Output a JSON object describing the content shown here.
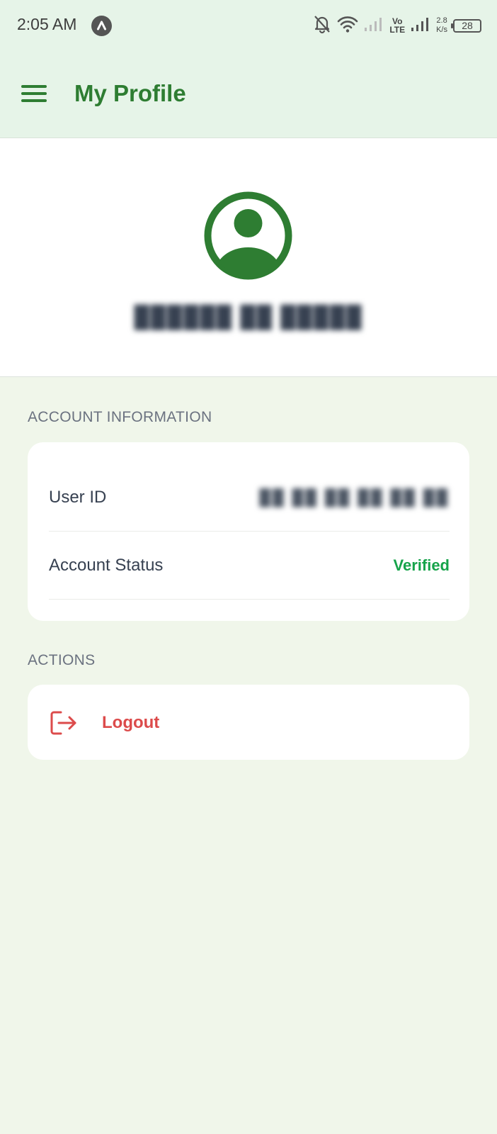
{
  "status_bar": {
    "time": "2:05 AM",
    "app_icon": "a-icon",
    "volte_top": "Vo",
    "volte_bottom": "LTE",
    "net_speed_value": "2.8",
    "net_speed_unit": "K/s",
    "battery": "28",
    "icons": [
      "bell-off-icon",
      "wifi-icon",
      "signal-icon",
      "signal-icon",
      "battery-icon"
    ]
  },
  "app_bar": {
    "title": "My Profile",
    "menu_icon": "hamburger-menu-icon"
  },
  "profile": {
    "avatar_icon": "user-avatar-icon",
    "name": "██████  ██  █████"
  },
  "account_information": {
    "section_title": "ACCOUNT INFORMATION",
    "rows": [
      {
        "label": "User ID",
        "value": "██ ██  ██ ██ ██ ██"
      },
      {
        "label": "Account Status",
        "value": "Verified"
      }
    ]
  },
  "actions": {
    "section_title": "ACTIONS",
    "logout_label": "Logout",
    "logout_icon": "logout-icon"
  },
  "colors": {
    "primary_green": "#2e7d32",
    "verified_green": "#16a34a",
    "logout_red": "#dc4b4b",
    "app_bar_bg": "#e6f4e8",
    "page_bg": "#f0f6ea"
  }
}
